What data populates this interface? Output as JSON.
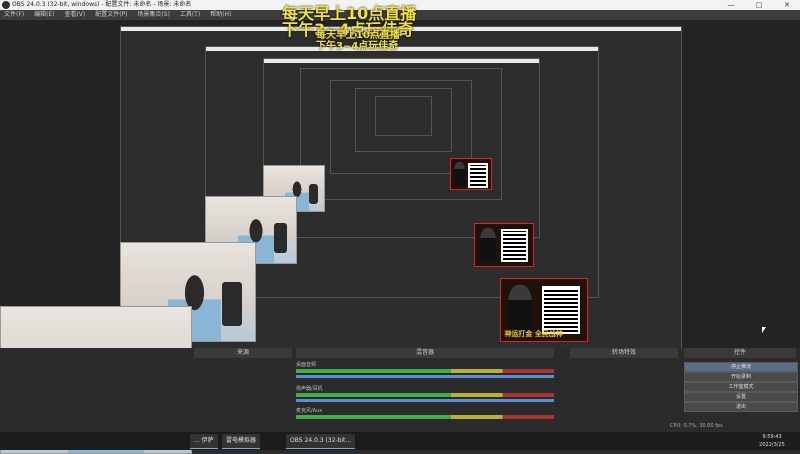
{
  "window": {
    "title": "OBS 24.0.3 (32-bit, windows) - 配置文件: 未命名 - 场景: 未命名",
    "controls": [
      "—",
      "□",
      "✕"
    ]
  },
  "menu": [
    "文件(F)",
    "编辑(E)",
    "查看(V)",
    "配置文件(P)",
    "场景集合(S)",
    "工具(T)",
    "帮助(H)"
  ],
  "overlay": {
    "line1": "每天早上10点直播",
    "line2": "下午3~4点玩佳奇"
  },
  "promo": {
    "text": "神运打金 全民战神"
  },
  "dock": {
    "sources_title": "来源",
    "mixer_title": "混音器",
    "transitions_title": "转场特效",
    "controls_title": "控件",
    "mixer": [
      {
        "name": "桌面音频",
        "db": "0.0 dB"
      },
      {
        "name": "扬声器/耳机",
        "db": "0.0 dB"
      },
      {
        "name": "麦克风/Aux",
        "db": "0.0 dB"
      }
    ],
    "transition_select": "淡出",
    "controls": [
      "停止推流",
      "开始录制",
      "工作室模式",
      "设置",
      "退出"
    ]
  },
  "status": {
    "cpu": "CPU: 0.7%, 30.00 fps",
    "live": "LIVE: 00:17:42",
    "rec": "REC: 00:00:00"
  },
  "taskbar": {
    "items": [
      "... 伊萨",
      "雷电模拟器",
      "OBS 24.0.3 (32-bit..."
    ],
    "time": "9:59:43",
    "date": "2022/3/25"
  }
}
